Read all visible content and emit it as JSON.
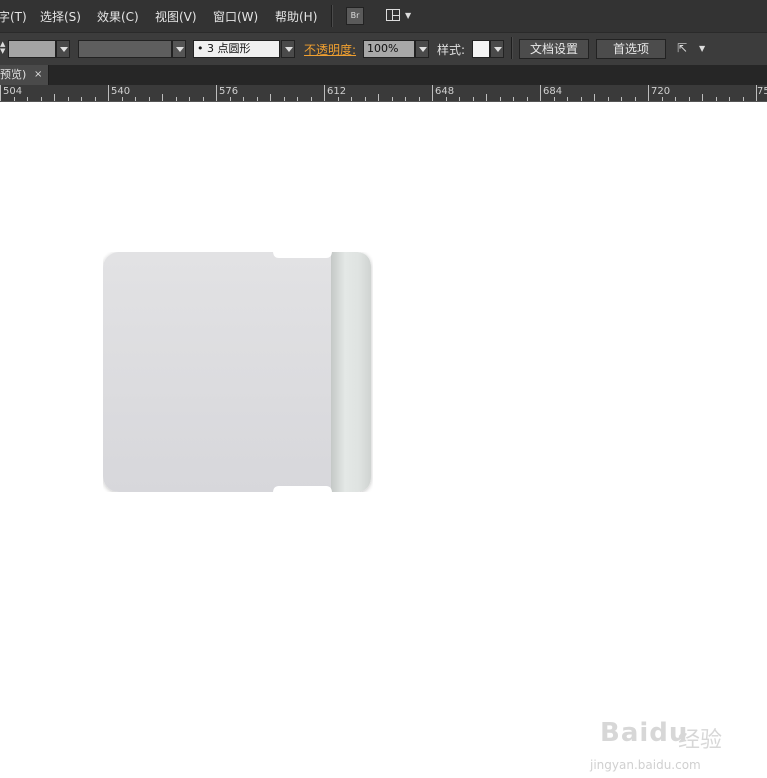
{
  "menu": {
    "items": [
      "字(T)",
      "选择(S)",
      "效果(C)",
      "视图(V)",
      "窗口(W)",
      "帮助(H)"
    ],
    "bridge_label": "Br"
  },
  "controls": {
    "brush_label": "• 3 点圆形",
    "opacity_label": "不透明度:",
    "opacity_value": "100%",
    "style_label": "样式:",
    "doc_setup_button": "文档设置",
    "preferences_button": "首选项"
  },
  "tab": {
    "title": "预览)",
    "close": "×"
  },
  "ruler": {
    "labels": [
      "504",
      "540",
      "576",
      "612",
      "648",
      "684",
      "720",
      "75"
    ]
  },
  "watermark": {
    "brand": "Baidu",
    "suffix": "经验",
    "url": "jingyan.baidu.com"
  },
  "colors": {
    "accent": "#f0a030",
    "card_top": "#e2e2e4",
    "card_bottom": "#d7d7db"
  }
}
